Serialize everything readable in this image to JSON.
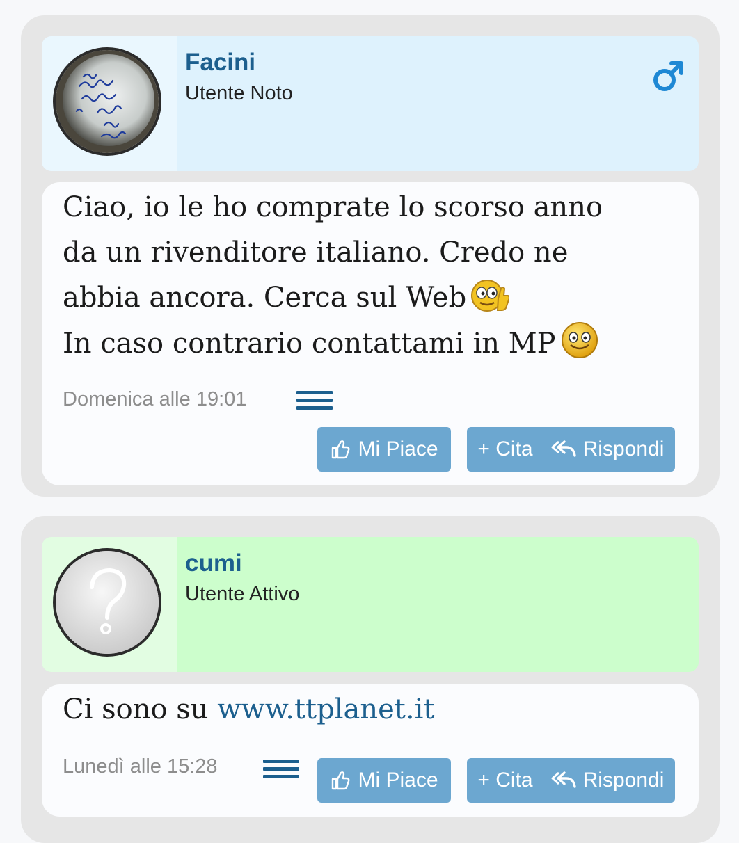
{
  "posts": [
    {
      "username": "Facini",
      "user_title": "Utente Noto",
      "gender_icon": "male-symbol-icon",
      "message_lines": [
        "Ciao, io le ho comprate lo scorso anno",
        "da un rivenditore italiano. Credo ne",
        "abbia ancora. Cerca sul Web",
        "In caso contrario contattami in MP"
      ],
      "timestamp": "Domenica alle 19:01",
      "buttons": {
        "like": "Mi Piace",
        "quote": "+ Cita",
        "reply": "Rispondi"
      }
    },
    {
      "username": "cumi",
      "user_title": "Utente Attivo",
      "message_prefix": "Ci sono su ",
      "message_link": "www.ttplanet.it",
      "timestamp": "Lunedì alle 15:28",
      "buttons": {
        "like": "Mi Piace",
        "quote": "+ Cita",
        "reply": "Rispondi"
      }
    }
  ],
  "colors": {
    "accent": "#1c5f8e",
    "button": "#6ca7d0",
    "post1_header": "#def2fd",
    "post2_header": "#ccfecc"
  }
}
